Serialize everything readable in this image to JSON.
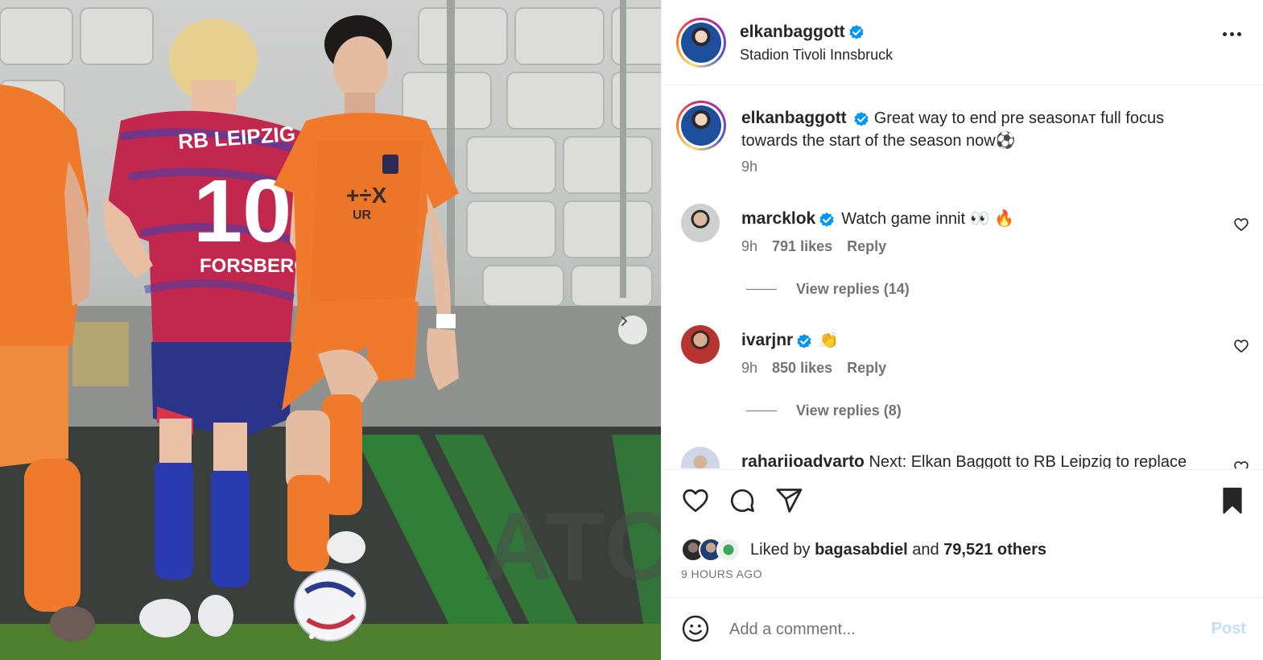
{
  "post": {
    "author": "elkanbaggott",
    "location": "Stadion Tivoli Innsbruck",
    "caption": "Great way to end pre seasonᴀᴛ full focus towards the start of the season now⚽",
    "caption_time": "9h"
  },
  "photo": {
    "shirt_text_front": "RB LEIPZIG",
    "shirt_number": "10",
    "shirt_name": "FORSBERG",
    "sponsor_text": "+÷X",
    "sponsor_sub": "UR",
    "banner_text": "ATCH",
    "next_icon": "chevron-right-icon"
  },
  "comments": [
    {
      "username": "marcklok",
      "text": "Watch game innit 👀 🔥",
      "time": "9h",
      "likes": "791 likes",
      "reply": "Reply",
      "view_replies": "View replies (14)"
    },
    {
      "username": "ivarjnr",
      "text": "👏",
      "time": "9h",
      "likes": "850 likes",
      "reply": "Reply",
      "view_replies": "View replies (8)"
    },
    {
      "username": "rahariioadvarto",
      "text": "Next: Elkan Baggott to RB Leipzig to replace"
    }
  ],
  "likes": {
    "prefix": "Liked by",
    "user": "bagasabdiel",
    "joiner": "and",
    "others": "79,521 others"
  },
  "time_ago": "9 HOURS AGO",
  "comment_box": {
    "placeholder": "Add a comment...",
    "post_label": "Post"
  },
  "colors": {
    "verified": "#0095f6",
    "post_disabled": "#c0dffd",
    "secondary_text": "#737373",
    "orange_kit": "#f07a2c",
    "leipzig_kit": "#c2284e"
  }
}
